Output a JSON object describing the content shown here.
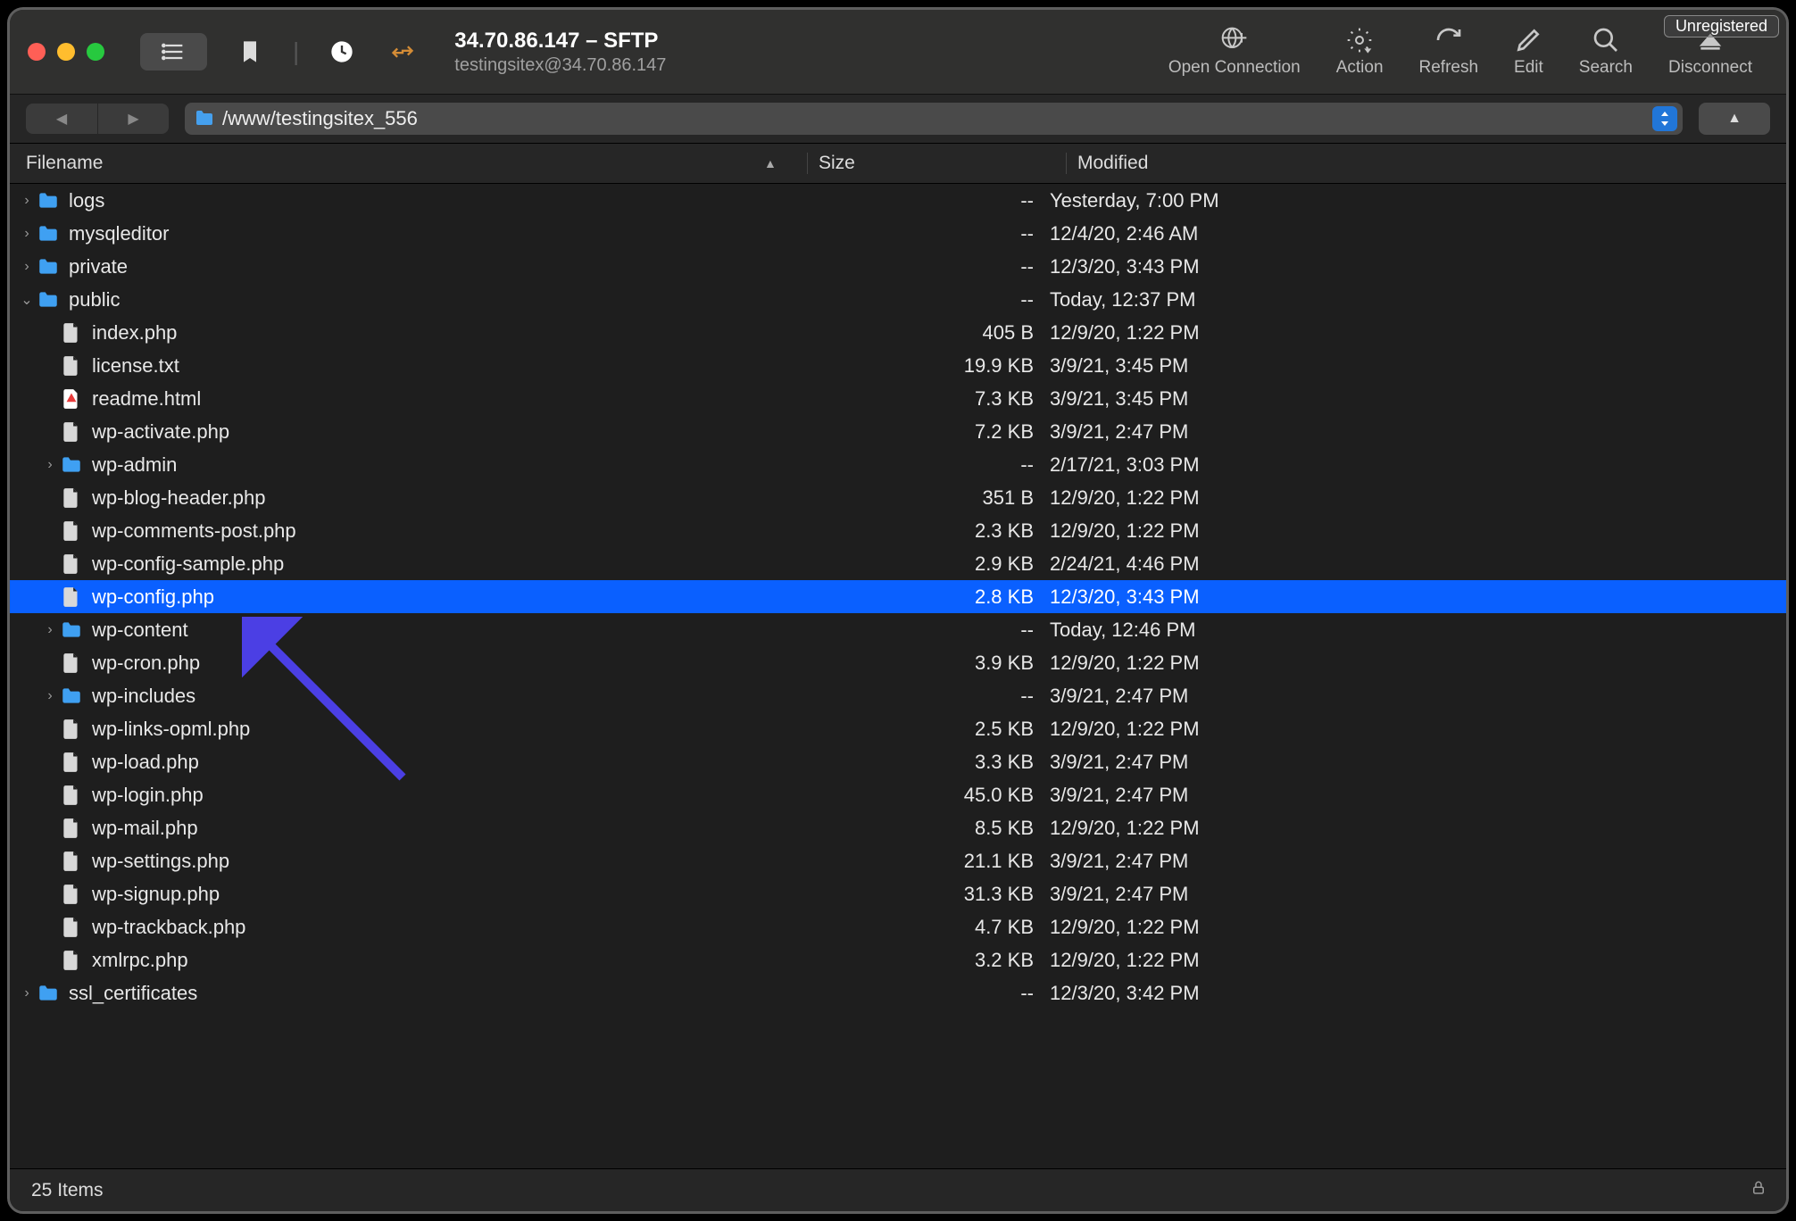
{
  "window": {
    "title": "34.70.86.147 – SFTP",
    "subtitle": "testingsitex@34.70.86.147",
    "unregistered_label": "Unregistered"
  },
  "toolbar": {
    "open_connection": "Open Connection",
    "action": "Action",
    "refresh": "Refresh",
    "edit": "Edit",
    "search": "Search",
    "disconnect": "Disconnect"
  },
  "path": "/www/testingsitex_556",
  "columns": {
    "filename": "Filename",
    "size": "Size",
    "modified": "Modified"
  },
  "folder_icon": "folder",
  "file_icon": "file",
  "files": [
    {
      "depth": 0,
      "type": "folder",
      "disclosure": ">",
      "name": "logs",
      "size": "--",
      "modified": "Yesterday, 7:00 PM"
    },
    {
      "depth": 0,
      "type": "folder",
      "disclosure": ">",
      "name": "mysqleditor",
      "size": "--",
      "modified": "12/4/20, 2:46 AM"
    },
    {
      "depth": 0,
      "type": "folder",
      "disclosure": ">",
      "name": "private",
      "size": "--",
      "modified": "12/3/20, 3:43 PM"
    },
    {
      "depth": 0,
      "type": "folder",
      "disclosure": "v",
      "name": "public",
      "size": "--",
      "modified": "Today, 12:37 PM"
    },
    {
      "depth": 1,
      "type": "file",
      "disclosure": "",
      "name": "index.php",
      "size": "405 B",
      "modified": "12/9/20, 1:22 PM"
    },
    {
      "depth": 1,
      "type": "file",
      "disclosure": "",
      "name": "license.txt",
      "size": "19.9 KB",
      "modified": "3/9/21, 3:45 PM"
    },
    {
      "depth": 1,
      "type": "file-red",
      "disclosure": "",
      "name": "readme.html",
      "size": "7.3 KB",
      "modified": "3/9/21, 3:45 PM"
    },
    {
      "depth": 1,
      "type": "file",
      "disclosure": "",
      "name": "wp-activate.php",
      "size": "7.2 KB",
      "modified": "3/9/21, 2:47 PM"
    },
    {
      "depth": 1,
      "type": "folder",
      "disclosure": ">",
      "name": "wp-admin",
      "size": "--",
      "modified": "2/17/21, 3:03 PM"
    },
    {
      "depth": 1,
      "type": "file",
      "disclosure": "",
      "name": "wp-blog-header.php",
      "size": "351 B",
      "modified": "12/9/20, 1:22 PM"
    },
    {
      "depth": 1,
      "type": "file",
      "disclosure": "",
      "name": "wp-comments-post.php",
      "size": "2.3 KB",
      "modified": "12/9/20, 1:22 PM"
    },
    {
      "depth": 1,
      "type": "file",
      "disclosure": "",
      "name": "wp-config-sample.php",
      "size": "2.9 KB",
      "modified": "2/24/21, 4:46 PM"
    },
    {
      "depth": 1,
      "type": "file",
      "disclosure": "",
      "name": "wp-config.php",
      "size": "2.8 KB",
      "modified": "12/3/20, 3:43 PM",
      "selected": true
    },
    {
      "depth": 1,
      "type": "folder",
      "disclosure": ">",
      "name": "wp-content",
      "size": "--",
      "modified": "Today, 12:46 PM"
    },
    {
      "depth": 1,
      "type": "file",
      "disclosure": "",
      "name": "wp-cron.php",
      "size": "3.9 KB",
      "modified": "12/9/20, 1:22 PM"
    },
    {
      "depth": 1,
      "type": "folder",
      "disclosure": ">",
      "name": "wp-includes",
      "size": "--",
      "modified": "3/9/21, 2:47 PM"
    },
    {
      "depth": 1,
      "type": "file",
      "disclosure": "",
      "name": "wp-links-opml.php",
      "size": "2.5 KB",
      "modified": "12/9/20, 1:22 PM"
    },
    {
      "depth": 1,
      "type": "file",
      "disclosure": "",
      "name": "wp-load.php",
      "size": "3.3 KB",
      "modified": "3/9/21, 2:47 PM"
    },
    {
      "depth": 1,
      "type": "file",
      "disclosure": "",
      "name": "wp-login.php",
      "size": "45.0 KB",
      "modified": "3/9/21, 2:47 PM"
    },
    {
      "depth": 1,
      "type": "file",
      "disclosure": "",
      "name": "wp-mail.php",
      "size": "8.5 KB",
      "modified": "12/9/20, 1:22 PM"
    },
    {
      "depth": 1,
      "type": "file",
      "disclosure": "",
      "name": "wp-settings.php",
      "size": "21.1 KB",
      "modified": "3/9/21, 2:47 PM"
    },
    {
      "depth": 1,
      "type": "file",
      "disclosure": "",
      "name": "wp-signup.php",
      "size": "31.3 KB",
      "modified": "3/9/21, 2:47 PM"
    },
    {
      "depth": 1,
      "type": "file",
      "disclosure": "",
      "name": "wp-trackback.php",
      "size": "4.7 KB",
      "modified": "12/9/20, 1:22 PM"
    },
    {
      "depth": 1,
      "type": "file",
      "disclosure": "",
      "name": "xmlrpc.php",
      "size": "3.2 KB",
      "modified": "12/9/20, 1:22 PM"
    },
    {
      "depth": 0,
      "type": "folder",
      "disclosure": ">",
      "name": "ssl_certificates",
      "size": "--",
      "modified": "12/3/20, 3:42 PM"
    }
  ],
  "status": {
    "items": "25 Items"
  }
}
